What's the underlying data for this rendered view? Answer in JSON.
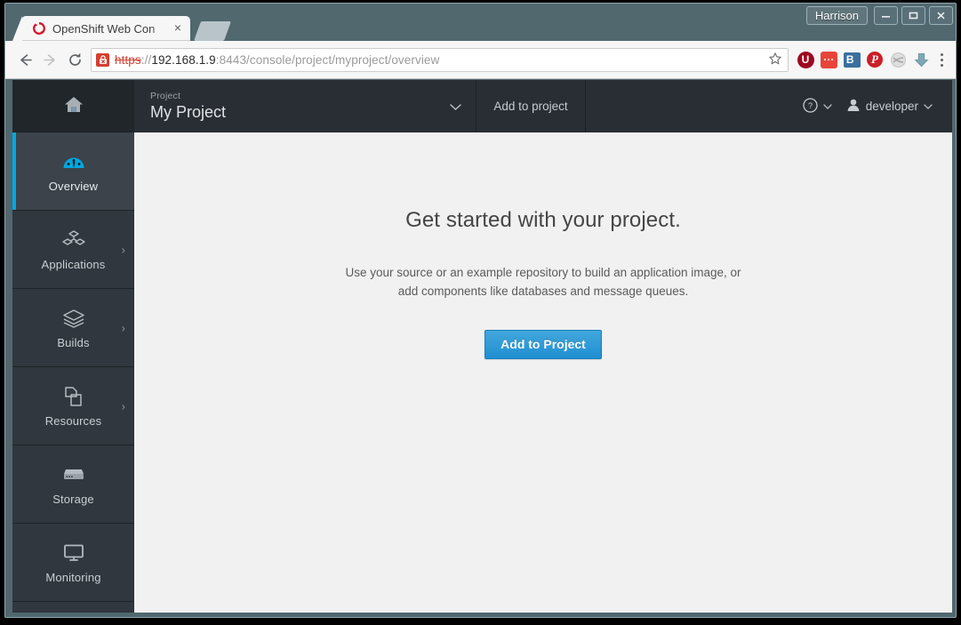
{
  "window": {
    "profile_label": "Harrison",
    "minimize_label": "Minimize",
    "maximize_label": "Maximize",
    "close_label": "Close"
  },
  "browser": {
    "tab": {
      "title": "OpenShift Web Con",
      "favicon": "openshift-logo-icon",
      "close_label": "×"
    },
    "newtab_label": "New tab",
    "toolbar": {
      "back_label": "Back",
      "forward_label": "Forward",
      "reload_label": "Reload",
      "bookmark_label": "Bookmark this page",
      "menu_label": "Customize and control Google Chrome"
    },
    "omnibox": {
      "security_state": "not-secure",
      "scheme": "https",
      "separator": "://",
      "host": "192.168.1.9",
      "path": ":8443/console/project/myproject/overview",
      "full_url": "https://192.168.1.9:8443/console/project/myproject/overview"
    },
    "extensions": [
      {
        "name": "ublock-origin-extension",
        "glyph": "U"
      },
      {
        "name": "dots-extension",
        "glyph": "•••"
      },
      {
        "name": "blue-b-extension",
        "glyph": "B"
      },
      {
        "name": "pinterest-extension",
        "glyph": "P"
      },
      {
        "name": "gray-circle-extension",
        "glyph": ""
      },
      {
        "name": "download-extension",
        "glyph": "⬇"
      }
    ]
  },
  "console": {
    "sidebar": {
      "home_label": "Home",
      "items": [
        {
          "label": "Overview",
          "icon": "dashboard-gauge-icon",
          "active": true,
          "expandable": false
        },
        {
          "label": "Applications",
          "icon": "cubes-icon",
          "active": false,
          "expandable": true
        },
        {
          "label": "Builds",
          "icon": "layers-icon",
          "active": false,
          "expandable": true
        },
        {
          "label": "Resources",
          "icon": "documents-icon",
          "active": false,
          "expandable": true
        },
        {
          "label": "Storage",
          "icon": "storage-drive-icon",
          "active": false,
          "expandable": false
        },
        {
          "label": "Monitoring",
          "icon": "monitor-icon",
          "active": false,
          "expandable": false
        }
      ]
    },
    "topnav": {
      "project_kicker": "Project",
      "project_name": "My Project",
      "project_chevron": "⌄",
      "add_to_project": "Add to project",
      "help_label": "",
      "help_chevron": "⌄",
      "user_name": "developer",
      "user_chevron": "⌄"
    },
    "main": {
      "heading": "Get started with your project.",
      "description": "Use your source or an example repository to build an application image, or add components like databases and message queues.",
      "primary_button": "Add to Project"
    },
    "colors": {
      "accent_blue": "#00a8e1",
      "button_blue": "#1f8fd1",
      "sidebar_bg": "#30373e",
      "sidebar_active_bg": "#3c434b",
      "topnav_bg": "#292e34",
      "content_bg": "#f1f1f1"
    }
  }
}
